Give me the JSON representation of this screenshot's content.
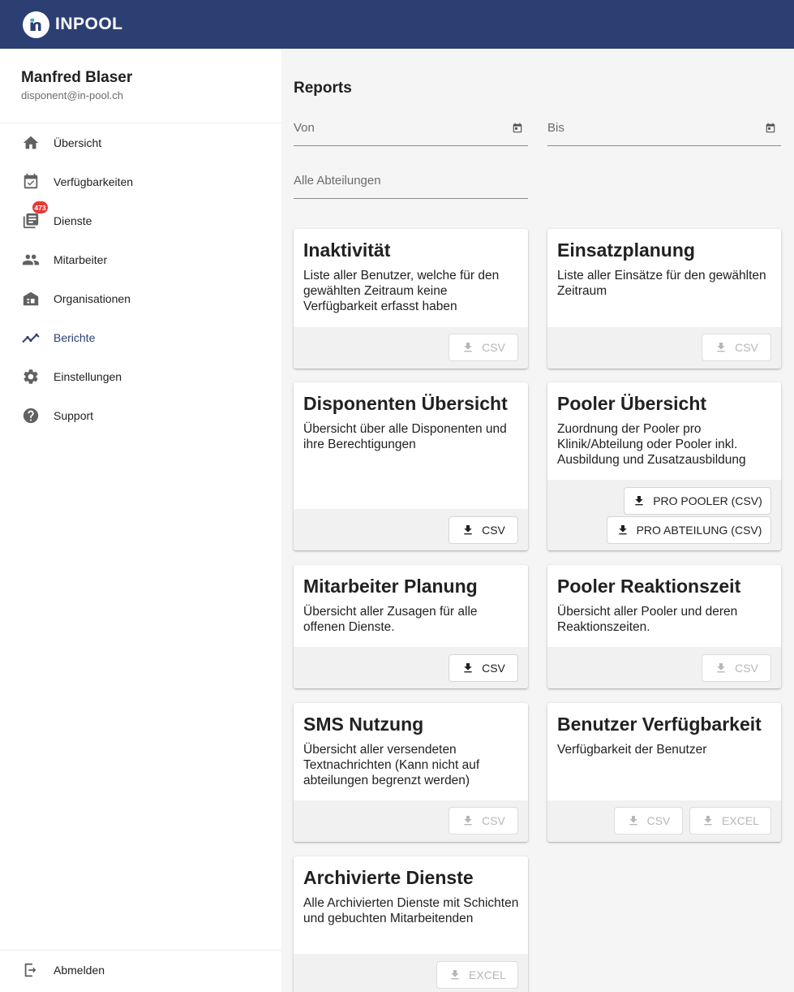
{
  "app": {
    "name": "INPOOL"
  },
  "user": {
    "name": "Manfred Blaser",
    "email": "disponent@in-pool.ch"
  },
  "sidebar": {
    "items": [
      {
        "label": "Übersicht",
        "icon": "home-icon"
      },
      {
        "label": "Verfügbarkeiten",
        "icon": "calendar-check-icon"
      },
      {
        "label": "Dienste",
        "icon": "list-icon",
        "badge": "473"
      },
      {
        "label": "Mitarbeiter",
        "icon": "people-icon"
      },
      {
        "label": "Organisationen",
        "icon": "building-icon"
      },
      {
        "label": "Berichte",
        "icon": "trending-icon",
        "active": true
      },
      {
        "label": "Einstellungen",
        "icon": "gear-icon"
      },
      {
        "label": "Support",
        "icon": "help-icon"
      }
    ],
    "logout": "Abmelden"
  },
  "main": {
    "title": "Reports",
    "filters": {
      "from": "Von",
      "to": "Bis",
      "department": "Alle Abteilungen"
    }
  },
  "cards": [
    {
      "title": "Inaktivität",
      "description": "Liste aller Benutzer, welche für den gewählten Zeitraum keine Verfügbarkeit erfasst haben",
      "buttons": [
        {
          "label": "CSV",
          "enabled": false
        }
      ]
    },
    {
      "title": "Einsatzplanung",
      "description": "Liste aller Einsätze für den gewählten Zeitraum",
      "buttons": [
        {
          "label": "CSV",
          "enabled": false
        }
      ]
    },
    {
      "title": "Disponenten Übersicht",
      "description": "Übersicht über alle Disponenten und ihre Berechtigungen",
      "buttons": [
        {
          "label": "CSV",
          "enabled": true
        }
      ]
    },
    {
      "title": "Pooler Übersicht",
      "description": "Zuordnung der Pooler pro Klinik/Abteilung oder Pooler inkl. Ausbildung und Zusatzausbildung",
      "buttons": [
        {
          "label": "PRO POOLER (CSV)",
          "enabled": true
        },
        {
          "label": "PRO ABTEILUNG (CSV)",
          "enabled": true
        }
      ]
    },
    {
      "title": "Mitarbeiter Planung",
      "description": "Übersicht aller Zusagen für alle offenen Dienste.",
      "buttons": [
        {
          "label": "CSV",
          "enabled": true
        }
      ]
    },
    {
      "title": "Pooler Reaktionszeit",
      "description": "Übersicht aller Pooler und deren Reaktionszeiten.",
      "buttons": [
        {
          "label": "CSV",
          "enabled": false
        }
      ]
    },
    {
      "title": "SMS Nutzung",
      "description": "Übersicht aller versendeten Textnachrichten (Kann nicht auf abteilungen begrenzt werden)",
      "buttons": [
        {
          "label": "CSV",
          "enabled": false
        }
      ]
    },
    {
      "title": "Benutzer Verfügbarkeit",
      "description": "Verfügbarkeit der Benutzer",
      "buttons": [
        {
          "label": "CSV",
          "enabled": false
        },
        {
          "label": "EXCEL",
          "enabled": false
        }
      ]
    },
    {
      "title": "Archivierte Dienste",
      "description": "Alle Archivierten Dienste mit Schichten und gebuchten Mitarbeitenden",
      "buttons": [
        {
          "label": "EXCEL",
          "enabled": false
        }
      ]
    }
  ],
  "colors": {
    "header": "#2b3f73",
    "accent": "#2b3f73",
    "badge": "#e53935",
    "disabled": "#b7b7b7"
  }
}
